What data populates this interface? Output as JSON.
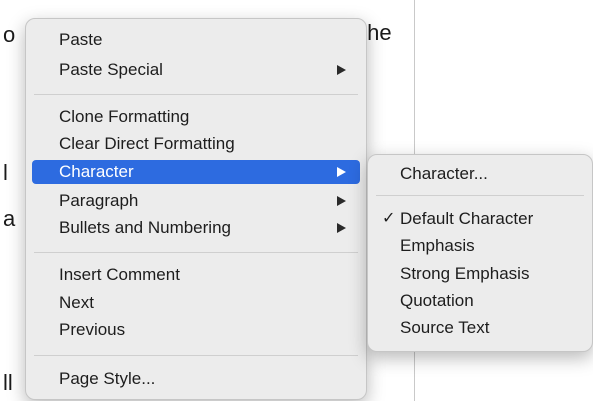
{
  "document": {
    "fragment_o": "o",
    "fragment_the": "the",
    "fragment_l1": "l",
    "fragment_a": "a",
    "fragment_l2": "ll"
  },
  "menu": {
    "items": [
      {
        "label": "Paste"
      },
      {
        "label": "Paste Special"
      },
      {
        "label": "Clone Formatting"
      },
      {
        "label": "Clear Direct Formatting"
      },
      {
        "label": "Character"
      },
      {
        "label": "Paragraph"
      },
      {
        "label": "Bullets and Numbering"
      },
      {
        "label": "Insert Comment"
      },
      {
        "label": "Next"
      },
      {
        "label": "Previous"
      },
      {
        "label": "Page Style..."
      }
    ]
  },
  "submenu": {
    "items": [
      {
        "label": "Character..."
      },
      {
        "label": "Default Character",
        "checked": true
      },
      {
        "label": "Emphasis"
      },
      {
        "label": "Strong Emphasis"
      },
      {
        "label": "Quotation"
      },
      {
        "label": "Source Text"
      }
    ],
    "check_mark": "✓"
  },
  "colors": {
    "menu_background": "#ececec",
    "highlight": "#2d6be0",
    "highlight_text": "#ffffff",
    "separator": "#cfcfcf"
  }
}
